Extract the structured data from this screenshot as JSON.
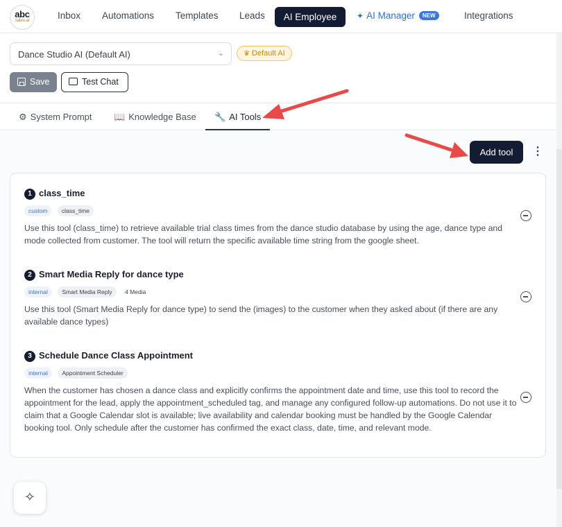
{
  "nav": {
    "logo_top": "abc",
    "logo_bottom": "sales.ai",
    "items": [
      "Inbox",
      "Automations",
      "Templates",
      "Leads"
    ],
    "active": "AI Employee",
    "manager": "AI Manager",
    "manager_badge": "NEW",
    "integrations": "Integrations"
  },
  "config": {
    "selected_ai": "Dance Studio AI (Default AI)",
    "default_badge": "Default AI",
    "save_label": "Save",
    "test_chat_label": "Test Chat"
  },
  "tabs": {
    "system_prompt": "System Prompt",
    "knowledge_base": "Knowledge Base",
    "ai_tools": "AI Tools"
  },
  "toolbar": {
    "add_tool_label": "Add tool"
  },
  "tools": [
    {
      "number": "1",
      "name": "class_time",
      "type": "custom",
      "tag": "class_time",
      "extra": "",
      "description": "Use this tool (class_time) to retrieve available trial class times from the dance studio database by using the age, dance type and mode collected from customer. The tool will return the specific available time string from the google sheet."
    },
    {
      "number": "2",
      "name": "Smart Media Reply for dance type",
      "type": "internal",
      "tag": "Smart Media Reply",
      "extra": "4 Media",
      "description": "Use this tool (Smart Media Reply for dance type) to send the (images) to the customer when they asked about (if there are any available dance types)"
    },
    {
      "number": "3",
      "name": "Schedule Dance Class Appointment",
      "type": "internal",
      "tag": "Appointment Scheduler",
      "extra": "",
      "description": "When the customer has chosen a dance class and explicitly confirms the appointment date and time, use this tool to record the appointment for the lead, apply the appointment_scheduled tag, and manage any configured follow-up automations. Do not use it to claim that a Google Calendar slot is available; live availability and calendar booking must be handled by the Google Calendar booking tool. Only schedule after the customer has confirmed the exact class, date, time, and relevant mode."
    }
  ],
  "colors": {
    "primary_dark": "#141c33",
    "accent_blue": "#2f6fd1",
    "annotation_arrow": "#e84a4a",
    "default_badge": "#c98a10"
  },
  "icons": {
    "fab": "sparkles-icon",
    "select": "chevron-down-icon",
    "save": "floppy-disk-icon",
    "test_chat": "chat-bubble-icon",
    "system_prompt": "gear-icon",
    "knowledge_base": "book-icon",
    "ai_tools": "wrench-icon",
    "remove": "minus-circle-icon",
    "more": "kebab-menu-icon"
  }
}
